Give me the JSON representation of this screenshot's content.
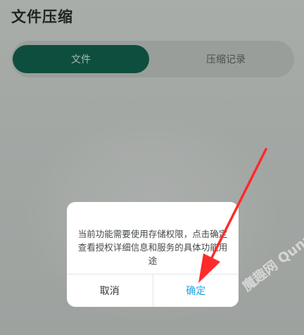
{
  "header": {
    "title": "文件压缩"
  },
  "tabs": [
    {
      "label": "文件",
      "selected": true
    },
    {
      "label": "压缩记录",
      "selected": false
    }
  ],
  "dialog": {
    "message": "当前功能需要使用存储权限，点击确定查看授权详细信息和服务的具体功能用途",
    "cancel_label": "取消",
    "confirm_label": "确定"
  },
  "watermark": {
    "text": "魔趣网 Qunz.com"
  },
  "colors": {
    "accent": "#0e4e3f",
    "confirm": "#1aa2e5",
    "arrow": "#ff2a2a",
    "dim_background": "#a4a8a6"
  }
}
